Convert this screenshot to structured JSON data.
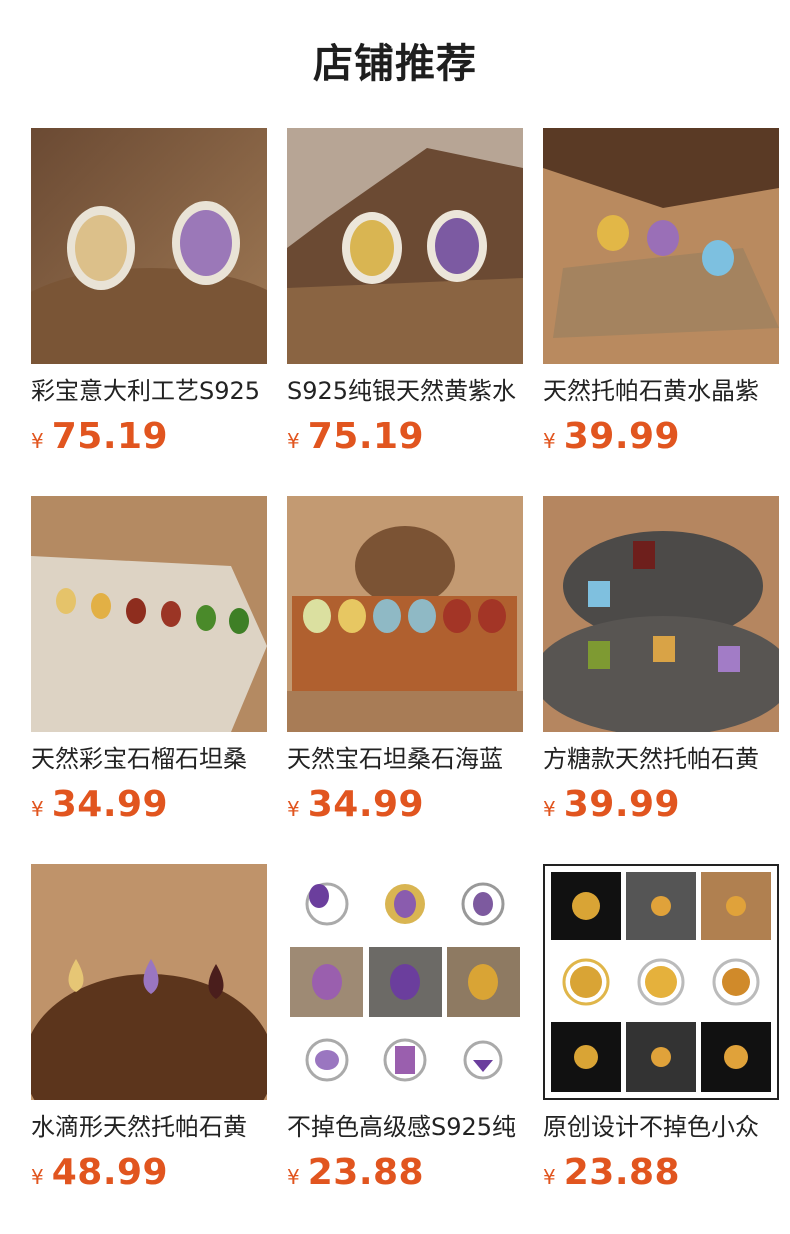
{
  "page": {
    "title": "店铺推荐"
  },
  "colors": {
    "price": "#e1551f",
    "title": "#1e1e1e"
  },
  "products": [
    {
      "name": "彩宝意大利工艺S925",
      "currency": "¥",
      "price": "75.19",
      "image": "ring-pair-citrine-amethyst"
    },
    {
      "name": "S925纯银天然黄紫水",
      "currency": "¥",
      "price": "75.19",
      "image": "ring-pair-on-rock"
    },
    {
      "name": "天然托帕石黄水晶紫",
      "currency": "¥",
      "price": "39.99",
      "image": "three-rings-on-stone"
    },
    {
      "name": "天然彩宝石榴石坦桑",
      "currency": "¥",
      "price": "34.99",
      "image": "six-earrings-marble"
    },
    {
      "name": "天然宝石坦桑石海蓝",
      "currency": "¥",
      "price": "34.99",
      "image": "six-earrings-pinecone"
    },
    {
      "name": "方糖款天然托帕石黄",
      "currency": "¥",
      "price": "39.99",
      "image": "emerald-cut-rings-pebbles"
    },
    {
      "name": "水滴形天然托帕石黄",
      "currency": "¥",
      "price": "48.99",
      "image": "pear-rings-on-wood"
    },
    {
      "name": "不掉色高级感S925纯",
      "currency": "¥",
      "price": "23.88",
      "image": "amethyst-ring-collage"
    },
    {
      "name": "原创设计不掉色小众",
      "currency": "¥",
      "price": "23.88",
      "image": "citrine-ring-collage"
    }
  ]
}
